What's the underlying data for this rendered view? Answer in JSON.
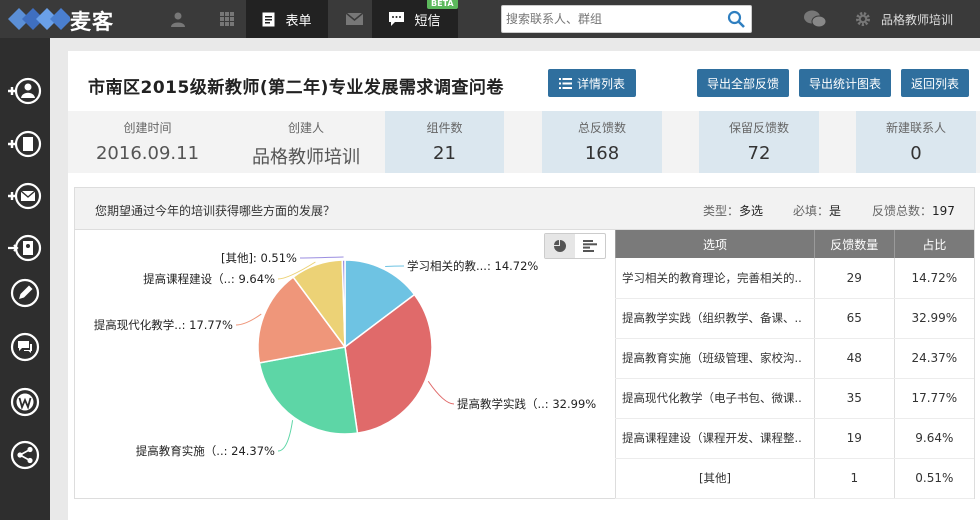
{
  "app": {
    "name": "麦客"
  },
  "nav": {
    "form_label": "表单",
    "sms_label": "短信",
    "beta_badge": "BETA",
    "search_placeholder": "搜索联系人、群组",
    "user_name": "品格教师培训"
  },
  "page": {
    "title": "市南区2015级新教师(第二年)专业发展需求调查问卷",
    "detail_btn": "详情列表",
    "export_all_btn": "导出全部反馈",
    "export_chart_btn": "导出统计图表",
    "back_btn": "返回列表"
  },
  "stats": [
    {
      "label": "创建时间",
      "value": "2016.09.11"
    },
    {
      "label": "创建人",
      "value": "品格教师培训"
    },
    {
      "label": "组件数",
      "value": "21"
    },
    {
      "label": "总反馈数",
      "value": "168"
    },
    {
      "label": "保留反馈数",
      "value": "72"
    },
    {
      "label": "新建联系人",
      "value": "0"
    }
  ],
  "question": {
    "text": "您期望通过今年的培训获得哪些方面的发展？",
    "type_label": "类型：",
    "type_value": "多选",
    "required_label": "必填：",
    "required_value": "是",
    "total_label": "反馈总数：",
    "total_value": "197"
  },
  "table": {
    "headers": [
      "选项",
      "反馈数量",
      "占比"
    ],
    "rows": [
      {
        "option": "学习相关的教育理论，完善相关的..",
        "count": "29",
        "pct": "14.72%"
      },
      {
        "option": "提高教学实践（组织教学、备课、..",
        "count": "65",
        "pct": "32.99%"
      },
      {
        "option": "提高教育实施（班级管理、家校沟..",
        "count": "48",
        "pct": "24.37%"
      },
      {
        "option": "提高现代化教学（电子书包、微课..",
        "count": "35",
        "pct": "17.77%"
      },
      {
        "option": "提高课程建设（课程开发、课程整..",
        "count": "19",
        "pct": "9.64%"
      },
      {
        "option": "[其他]",
        "count": "1",
        "pct": "0.51%"
      }
    ]
  },
  "chart_data": {
    "type": "pie",
    "slices": [
      {
        "label": "学习相关的教...: 14.72%",
        "value": 14.72,
        "color": "#6ec3e3"
      },
      {
        "label": "提高教学实践（..: 32.99%",
        "value": 32.99,
        "color": "#e06a6a"
      },
      {
        "label": "提高教育实施（..: 24.37%",
        "value": 24.37,
        "color": "#5dd6a6"
      },
      {
        "label": "提高现代化教学..: 17.77%",
        "value": 17.77,
        "color": "#ef967a"
      },
      {
        "label": "提高课程建设（..: 9.64%",
        "value": 9.64,
        "color": "#ecd276"
      },
      {
        "label": "[其他]: 0.51%",
        "value": 0.51,
        "color": "#9b8ee0"
      }
    ]
  }
}
